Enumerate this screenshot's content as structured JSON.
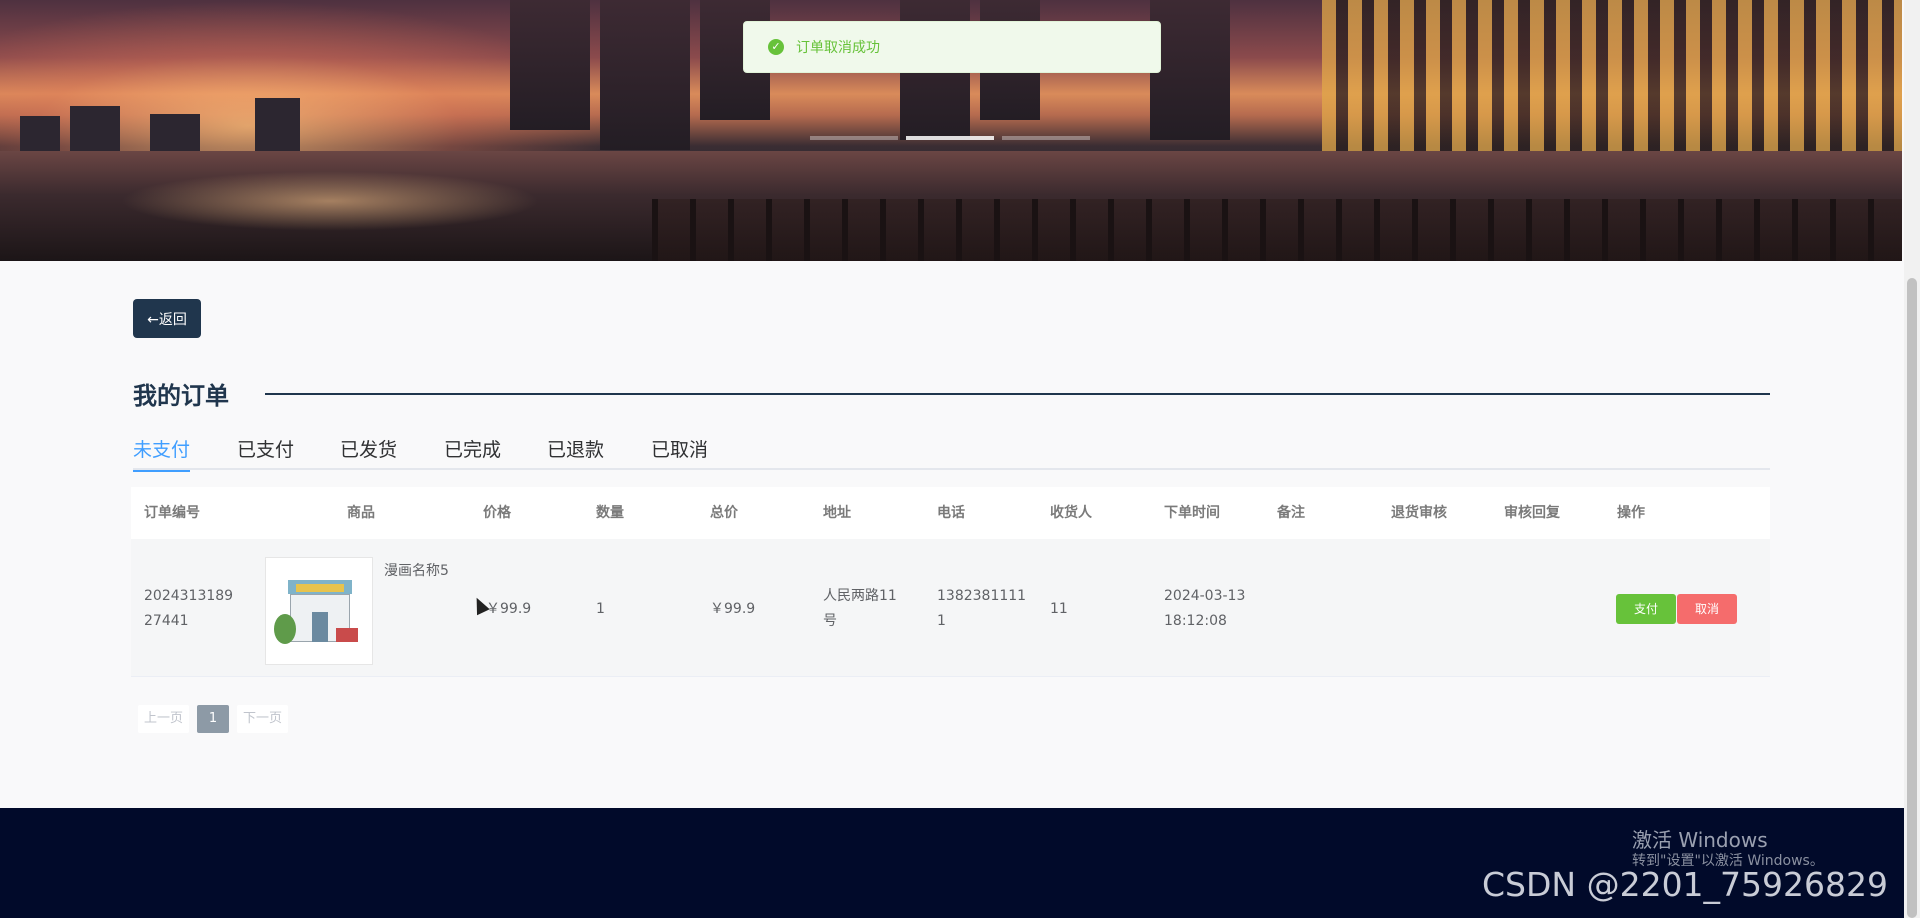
{
  "toast": {
    "message": "订单取消成功"
  },
  "back_button": {
    "label": "←返回"
  },
  "page_title": "我的订单",
  "tabs": [
    {
      "label": "未支付",
      "active": true
    },
    {
      "label": "已支付",
      "active": false
    },
    {
      "label": "已发货",
      "active": false
    },
    {
      "label": "已完成",
      "active": false
    },
    {
      "label": "已退款",
      "active": false
    },
    {
      "label": "已取消",
      "active": false
    }
  ],
  "table": {
    "headers": [
      "订单编号",
      "商品",
      "价格",
      "数量",
      "总价",
      "地址",
      "电话",
      "收货人",
      "下单时间",
      "备注",
      "退货审核",
      "审核回复",
      "操作"
    ],
    "rows": [
      {
        "order_no_line1": "2024313189",
        "order_no_line2": "27441",
        "product_name": "漫画名称5",
        "price": "￥99.9",
        "quantity": "1",
        "total": "￥99.9",
        "address_line1": "人民两路11",
        "address_line2": "号",
        "phone_line1": "1382381111",
        "phone_line2": "1",
        "receiver": "11",
        "order_time_line1": "2024-03-13",
        "order_time_line2": "18:12:08",
        "remark": "",
        "return_review": "",
        "review_reply": "",
        "pay_label": "支付",
        "cancel_label": "取消"
      }
    ]
  },
  "pagination": {
    "prev": "上一页",
    "current": "1",
    "next": "下一页"
  },
  "watermarks": {
    "windows_line1": "激活 Windows",
    "windows_line2": "转到\"设置\"以激活 Windows。",
    "csdn": "CSDN @2201_75926829"
  },
  "colors": {
    "accent": "#409eff",
    "primary_dark": "#20364d",
    "success": "#67c23a",
    "danger": "#f56c6c",
    "footer": "#010a2a"
  }
}
